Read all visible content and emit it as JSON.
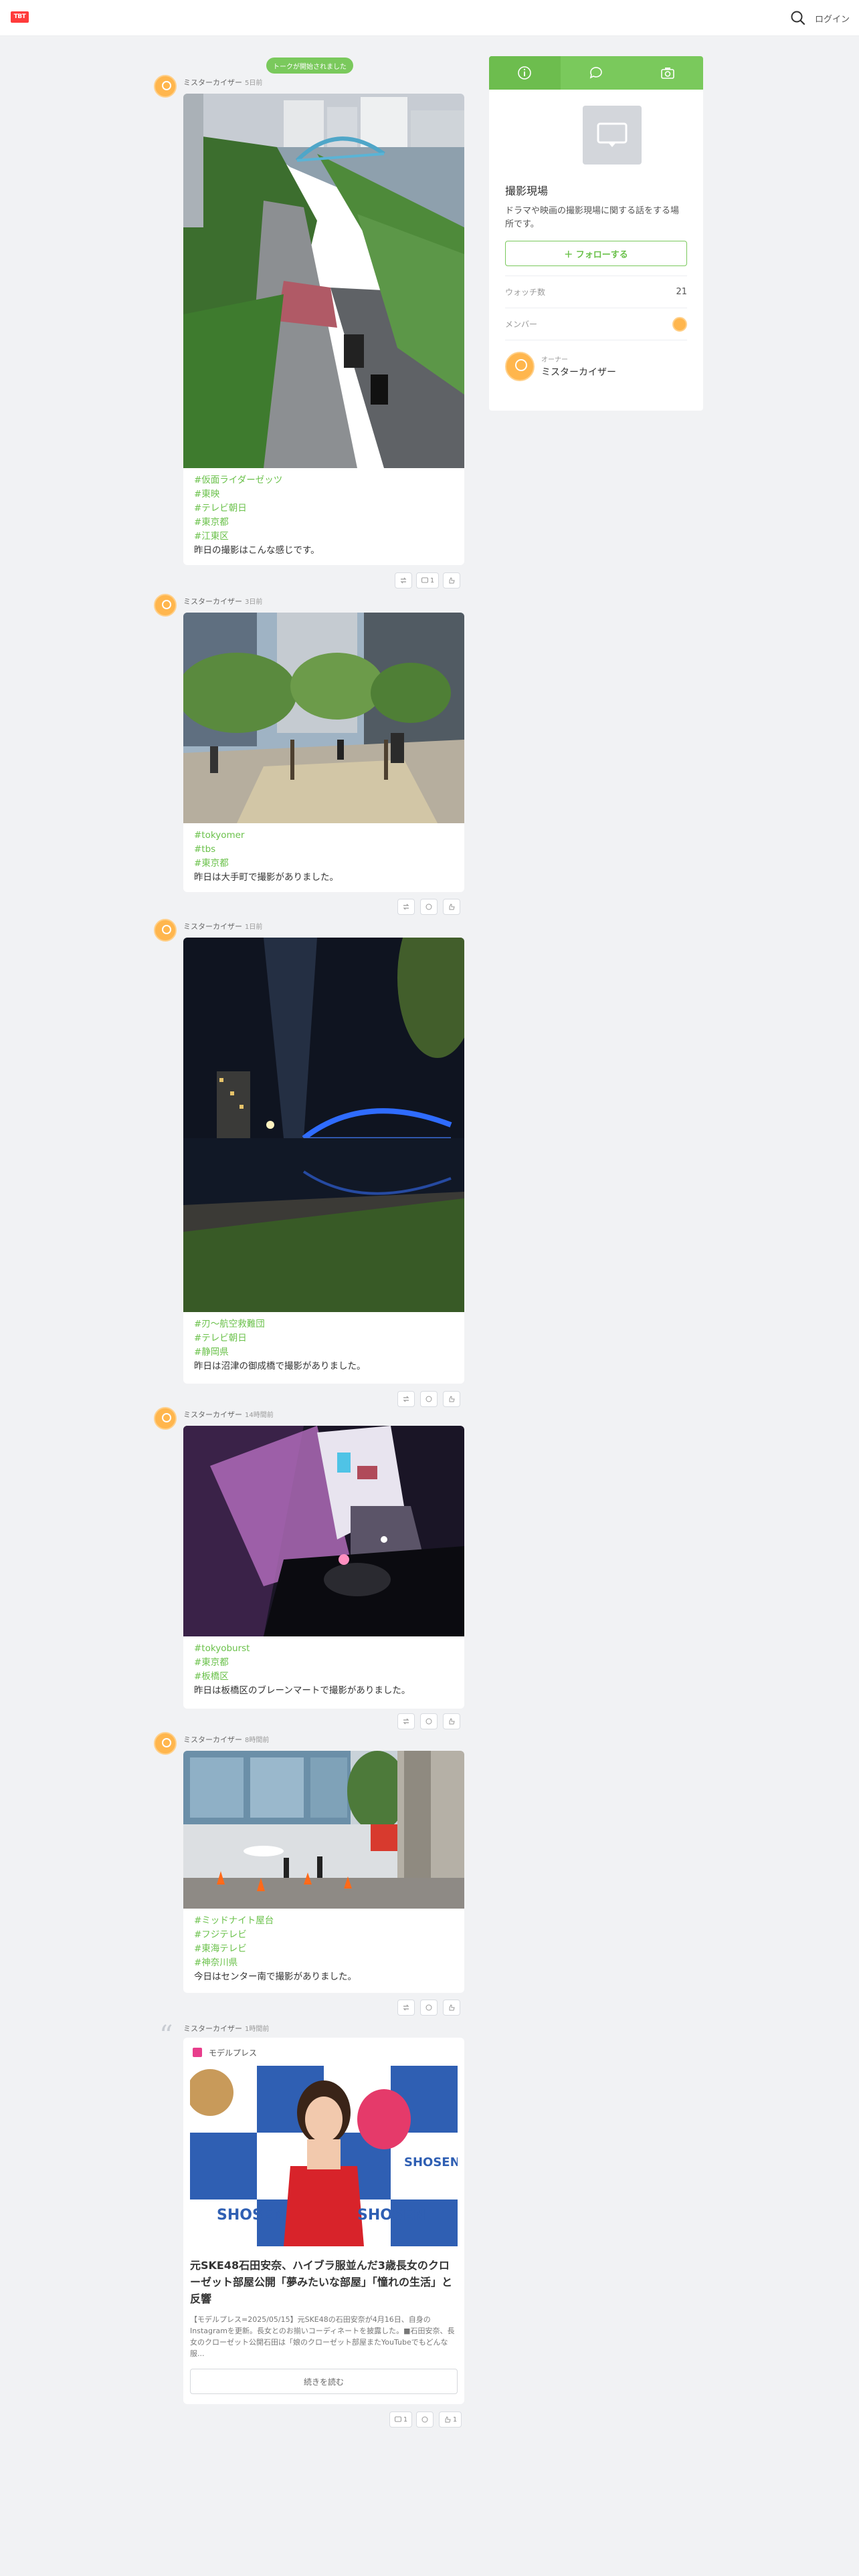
{
  "header": {
    "logo_text": "TBT",
    "login_label": "ログイン"
  },
  "notice": "トークが開始されました",
  "sidebar": {
    "title": "撮影現場",
    "description": "ドラマや映画の撮影現場に関する話をする場所です。",
    "follow_label": "＋ フォローする",
    "watch_label": "ウォッチ数",
    "watch_count": "21",
    "member_label": "メンバー",
    "owner_label": "オーナー",
    "owner_name": "ミスターカイザー",
    "tabs": [
      "info-icon",
      "chat-icon",
      "camera-icon"
    ]
  },
  "posts": [
    {
      "author": "ミスターカイザー",
      "time": "5日前",
      "tags": [
        "#仮面ライダーゼッツ",
        "#東映",
        "#テレビ朝日",
        "#東京都",
        "#江東区"
      ],
      "caption": "昨日の撮影はこんな感じです。",
      "comment_count": "1"
    },
    {
      "author": "ミスターカイザー",
      "time": "3日前",
      "tags": [
        "#tokyomer",
        "#tbs",
        "#東京都"
      ],
      "caption": "昨日は大手町で撮影がありました。"
    },
    {
      "author": "ミスターカイザー",
      "time": "1日前",
      "tags": [
        "#刃〜航空救難団",
        "#テレビ朝日",
        "#静岡県"
      ],
      "caption": "昨日は沼津の御成橋で撮影がありました。"
    },
    {
      "author": "ミスターカイザー",
      "time": "14時間前",
      "tags": [
        "#tokyoburst",
        "#東京都",
        "#板橋区"
      ],
      "caption": "昨日は板橋区のブレーンマートで撮影がありました。"
    },
    {
      "author": "ミスターカイザー",
      "time": "8時間前",
      "tags": [
        "#ミッドナイト屋台",
        "#フジテレビ",
        "#東海テレビ",
        "#神奈川県"
      ],
      "caption": "今日はセンター南で撮影がありました。"
    },
    {
      "author": "ミスターカイザー",
      "time": "1時間前",
      "link": {
        "source": "モデルプレス",
        "title": "元SKE48石田安奈、ハイブラ服並んだ3歳長女のクローゼット部屋公開「夢みたいな部屋」「憧れの生活」と反響",
        "description": "【モデルプレス=2025/05/15】元SKE48の石田安奈が4月16日、自身のInstagramを更新。長女とのお揃いコーディネートを披露した。■石田安奈、長女のクローゼット公開石田は「娘のクローゼット部屋またYouTubeでもどんな服...",
        "read_more": "続きを読む",
        "image_text_1": "SHOSEN",
        "image_text_2": "SHOSEN",
        "image_text_3": "SHOSEN"
      },
      "comment_count": "1",
      "share_count": "1"
    }
  ]
}
